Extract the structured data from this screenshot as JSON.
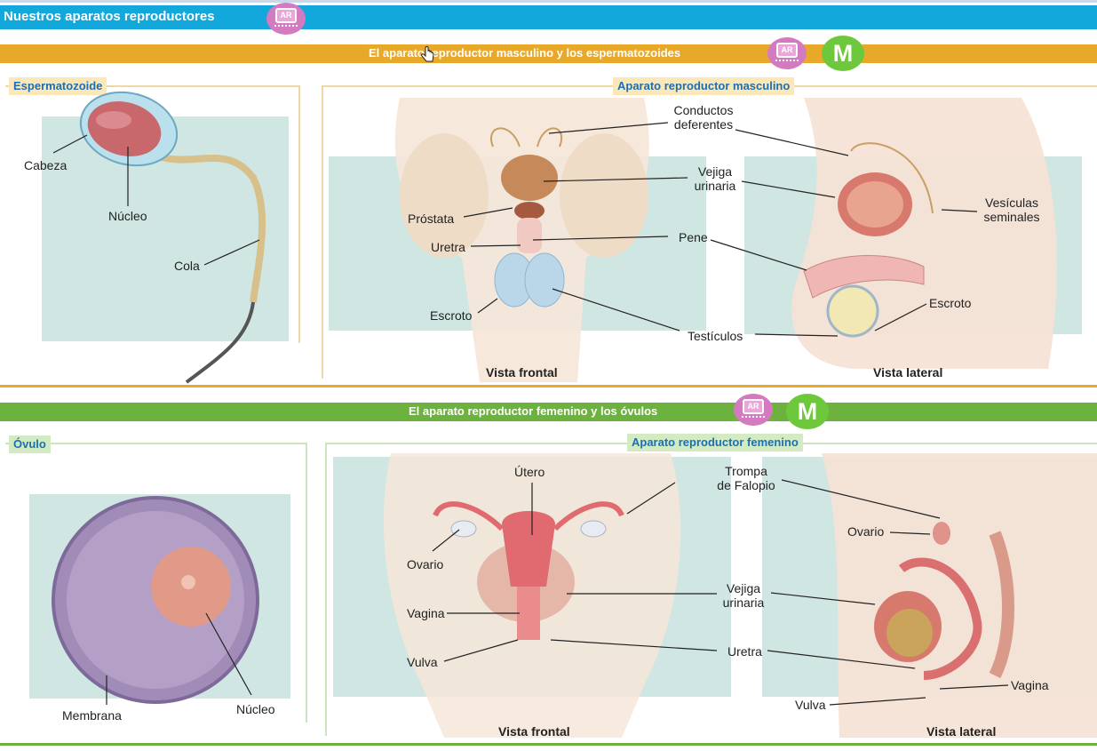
{
  "header": {
    "title": "Nuestros aparatos reproductores",
    "ar_badge_text": "AR"
  },
  "male": {
    "band_title": "El aparato reproductor masculino y los espermatozoides",
    "m_badge": "M",
    "sperm_label": "Espermatozoide",
    "system_label": "Aparato reproductor masculino",
    "sperm_parts": {
      "cabeza": "Cabeza",
      "nucleo": "Núcleo",
      "cola": "Cola"
    },
    "frontal": {
      "conductos": "Conductos\ndeferentes",
      "vejiga": "Vejiga\nurinaria",
      "prostata": "Próstata",
      "uretra": "Uretra",
      "pene": "Pene",
      "escroto": "Escroto",
      "testiculos": "Testículos",
      "caption": "Vista frontal"
    },
    "lateral": {
      "vesiculas": "Vesículas\nseminales",
      "escroto": "Escroto",
      "caption": "Vista lateral"
    }
  },
  "female": {
    "band_title": "El aparato reproductor femenino y los óvulos",
    "m_badge": "M",
    "ovule_label": "Óvulo",
    "system_label": "Aparato reproductor femenino",
    "ovule_parts": {
      "membrana": "Membrana",
      "nucleo": "Núcleo"
    },
    "frontal": {
      "utero": "Útero",
      "trompa": "Trompa\nde Falopio",
      "ovario": "Ovario",
      "vejiga": "Vejiga\nurinaria",
      "vagina": "Vagina",
      "uretra": "Uretra",
      "vulva": "Vulva",
      "caption": "Vista frontal"
    },
    "lateral": {
      "ovario": "Ovario",
      "vagina": "Vagina",
      "vulva": "Vulva",
      "caption": "Vista lateral"
    }
  },
  "colors": {
    "title_bar": "#12a8dc",
    "male_band": "#e8a92a",
    "female_band": "#6db23e",
    "label_text": "#1a6fb5",
    "ar_badge": "#d47ac0",
    "m_badge": "#6dc93b"
  },
  "icons": {
    "ar": "ar-tablet-icon",
    "m": "m-letter-icon",
    "cursor": "hand-cursor-icon"
  }
}
